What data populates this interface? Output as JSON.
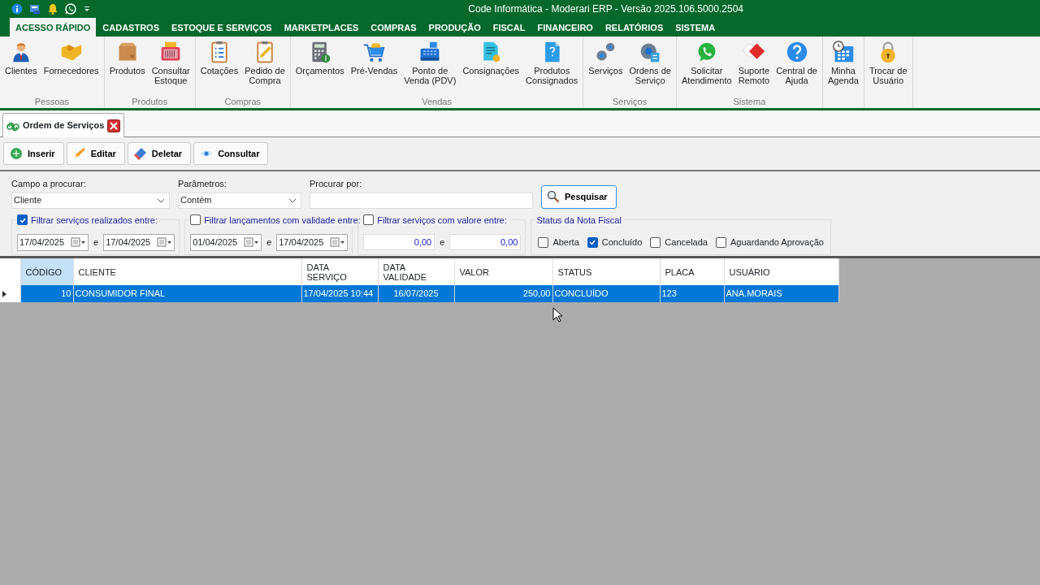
{
  "window": {
    "title": "Code Informática - Moderari ERP - Versão 2025.106.5000.2504"
  },
  "ribbon": {
    "tabs": [
      {
        "label": "ACESSO RÁPIDO",
        "selected": true
      },
      {
        "label": "CADASTROS",
        "selected": false
      },
      {
        "label": "ESTOQUE E SERVIÇOS",
        "selected": false
      },
      {
        "label": "MARKETPLACES",
        "selected": false
      },
      {
        "label": "COMPRAS",
        "selected": false
      },
      {
        "label": "PRODUÇÃO",
        "selected": false
      },
      {
        "label": "FISCAL",
        "selected": false
      },
      {
        "label": "FINANCEIRO",
        "selected": false
      },
      {
        "label": "RELATÓRIOS",
        "selected": false
      },
      {
        "label": "SISTEMA",
        "selected": false
      }
    ],
    "groups": [
      {
        "label": "Pessoas",
        "items": [
          {
            "label": "Clientes"
          },
          {
            "label": "Fornecedores"
          }
        ]
      },
      {
        "label": "Produtos",
        "items": [
          {
            "label": "Produtos"
          },
          {
            "label": "Consultar\nEstoque"
          }
        ]
      },
      {
        "label": "Compras",
        "items": [
          {
            "label": "Cotações"
          },
          {
            "label": "Pedido de\nCompra"
          }
        ]
      },
      {
        "label": "Vendas",
        "items": [
          {
            "label": "Orçamentos"
          },
          {
            "label": "Pré-Vendas"
          },
          {
            "label": "Ponto de\nVenda (PDV)"
          },
          {
            "label": "Consignações"
          },
          {
            "label": "Produtos\nConsignados"
          }
        ]
      },
      {
        "label": "Serviços",
        "items": [
          {
            "label": "Serviços"
          },
          {
            "label": "Ordens de\nServiço"
          }
        ]
      },
      {
        "label": "Sistema",
        "items": [
          {
            "label": "Solicitar\nAtendimento"
          },
          {
            "label": "Suporte\nRemoto"
          },
          {
            "label": "Central de\nAjuda"
          }
        ]
      },
      {
        "items": [
          {
            "label": "Minha\nAgenda"
          }
        ]
      },
      {
        "items": [
          {
            "label": "Trocar de\nUsuário"
          }
        ]
      }
    ]
  },
  "document_tab": {
    "title": "Ordem de Serviços"
  },
  "toolbar": {
    "buttons": [
      {
        "label": "Inserir"
      },
      {
        "label": "Editar"
      },
      {
        "label": "Deletar"
      },
      {
        "label": "Consultar"
      }
    ]
  },
  "search": {
    "field": {
      "label": "Campo a procurar:",
      "value": "Cliente"
    },
    "parameter": {
      "label": "Parâmetros:",
      "value": "Contém"
    },
    "query": {
      "label": "Procurar por:"
    },
    "button": "Pesquisar"
  },
  "filters": [
    {
      "kind": "date",
      "label": "Filtrar serviços realizados entre:",
      "checked": true,
      "from": "17/04/2025",
      "separator": "e",
      "to": "17/04/2025"
    },
    {
      "kind": "date",
      "label": "Filtrar lançamentos com validade entre:",
      "checked": false,
      "from": "01/04/2025",
      "separator": "e",
      "to": "17/04/2025"
    },
    {
      "kind": "number",
      "label": "Filtrar serviços com valore entre:",
      "checked": false,
      "from": "0,00",
      "separator": "e",
      "to": "0,00"
    }
  ],
  "invoice_status": {
    "title": "Status da Nota Fiscal",
    "options": [
      {
        "label": "Aberta",
        "checked": false
      },
      {
        "label": "Concluído",
        "checked": true
      },
      {
        "label": "Cancelada",
        "checked": false
      },
      {
        "label": "Aguardando Aprovação",
        "checked": false
      }
    ]
  },
  "table": {
    "columns": [
      {
        "label": "CÓDIGO",
        "selected": true
      },
      {
        "label": "CLIENTE",
        "selected": false
      },
      {
        "label": "DATA\nSERVIÇO",
        "selected": false
      },
      {
        "label": "DATA\nVALIDADE",
        "selected": false
      },
      {
        "label": "VALOR",
        "selected": false
      },
      {
        "label": "STATUS",
        "selected": false
      },
      {
        "label": "PLACA",
        "selected": false
      },
      {
        "label": "USUÁRIO",
        "selected": false
      }
    ],
    "rows": [
      {
        "selected": true,
        "cells": [
          "10",
          "CONSUMIDOR FINAL",
          "17/04/2025 10:44",
          "16/07/2025",
          "250,00",
          "CONCLUÍDO",
          "123",
          "ANA.MORAIS"
        ]
      }
    ]
  }
}
